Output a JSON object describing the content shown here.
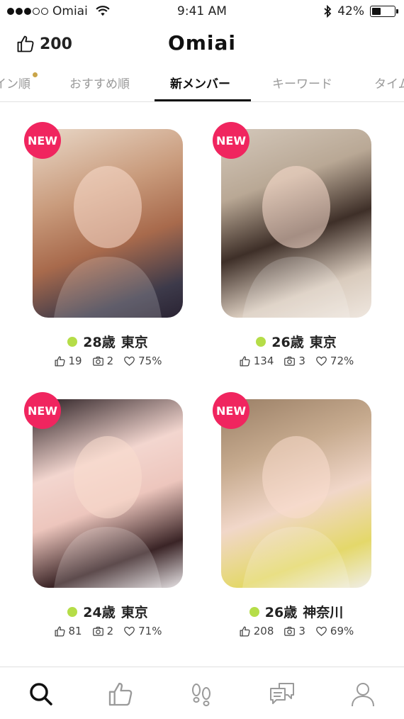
{
  "status_bar": {
    "carrier": "Omiai",
    "time": "9:41 AM",
    "battery": "42%",
    "battery_level": 0.42
  },
  "header": {
    "likes_count": "200",
    "logo": "Omiai"
  },
  "tabs": [
    {
      "label": "イン順",
      "has_dot": true
    },
    {
      "label": "おすすめ順"
    },
    {
      "label": "新メンバー",
      "active": true
    },
    {
      "label": "キーワード"
    },
    {
      "label": "タイム"
    }
  ],
  "badge_label": "NEW",
  "colors": {
    "badge": "#f0255f",
    "online": "#b5dd48"
  },
  "profiles": [
    {
      "age": "28歳",
      "location": "東京",
      "likes": "19",
      "photos": "2",
      "match": "75%",
      "photo_icon": "person-photo"
    },
    {
      "age": "26歳",
      "location": "東京",
      "likes": "134",
      "photos": "3",
      "match": "72%",
      "photo_icon": "person-photo"
    },
    {
      "age": "24歳",
      "location": "東京",
      "likes": "81",
      "photos": "2",
      "match": "71%",
      "photo_icon": "person-photo"
    },
    {
      "age": "26歳",
      "location": "神奈川",
      "likes": "208",
      "photos": "3",
      "match": "69%",
      "photo_icon": "person-photo"
    }
  ],
  "tabbar": {
    "icons": [
      "search-icon",
      "like-icon",
      "footprints-icon",
      "messages-icon",
      "profile-icon"
    ]
  }
}
